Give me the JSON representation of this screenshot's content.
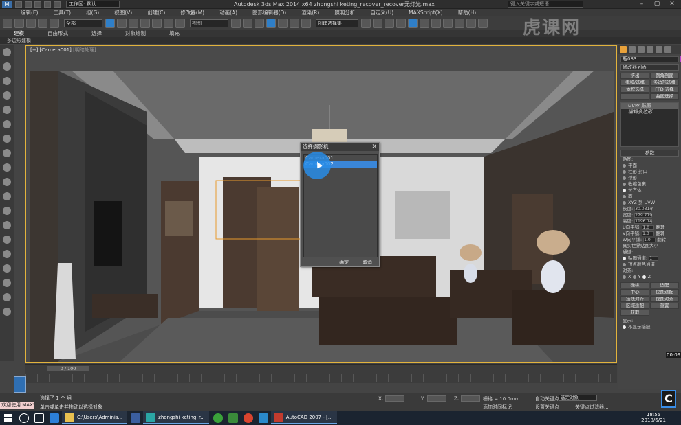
{
  "window": {
    "workspace_label": "工作区: 默认",
    "title": "Autodesk 3ds Max  2014 x64      zhongshi keting_recover_recover无灯光.max",
    "search_placeholder": "键入关键字或短语"
  },
  "menu": [
    "编辑(E)",
    "工具(T)",
    "组(G)",
    "视图(V)",
    "创建(C)",
    "修改器(M)",
    "动画(A)",
    "图形编辑器(D)",
    "渲染(R)",
    "照明分析",
    "自定义(U)",
    "MAXScript(X)",
    "帮助(H)"
  ],
  "toolbar": {
    "filter_value": "全部",
    "view_value": "视图",
    "selection_set_value": "创建选择集"
  },
  "ribbon": {
    "tabs": [
      "建模",
      "自由形式",
      "选择",
      "对象绘制",
      "填充"
    ],
    "sub_label": "多边形建模"
  },
  "viewport": {
    "label": "[+] [Camera001]",
    "label_dim": "[明暗处理]"
  },
  "dialog": {
    "title": "选择摄影机",
    "close": "✕",
    "items": [
      "Camera001",
      "Camera002"
    ],
    "ok_label": "确定",
    "cancel_label": "取消"
  },
  "command_panel": {
    "object_name": "瓶083",
    "modifier_list": "修改器列表",
    "buttons": [
      "挤出",
      "倒角剖面",
      "柔和/选择",
      "多边形选择",
      "体积选择",
      "FFD 选择",
      "",
      "曲面选择"
    ],
    "stack": [
      "UVW 贴图",
      "编辑多边形"
    ],
    "rollout_title": "参数",
    "mapping_label": "贴图:",
    "mapping_options": [
      "平面",
      "柱形",
      "封口",
      "球形",
      "收缩包裹",
      "长方体",
      "面",
      "XYZ 到 UVW"
    ],
    "length_label": "长度:",
    "length_value": "30.031m",
    "width_label": "宽度:",
    "width_value": "279.779",
    "height_label": "高度:",
    "height_value": "1196.14",
    "utile_label": "U向平铺:",
    "utile_value": "1.0",
    "vtile_label": "V向平铺:",
    "vtile_value": "1.0",
    "wtile_label": "W向平铺:",
    "wtile_value": "1.0",
    "flip_label": "翻转",
    "real_world_label": "真实世界贴图大小",
    "channel_label": "通道:",
    "map_channel_label": "贴图通道:",
    "map_channel_value": "1",
    "vertex_channel_label": "顶点颜色通道",
    "align_label": "对齐:",
    "align_axes": [
      "X",
      "Y",
      "Z"
    ],
    "align_buttons": [
      "操纵",
      "适配",
      "中心",
      "位图适配",
      "法线对齐",
      "视图对齐",
      "区域适配",
      "重置",
      "获取"
    ],
    "display_label": "显示:",
    "display_option": "不显示接缝"
  },
  "timeline": {
    "frame_label": "0 / 100"
  },
  "status": {
    "maxscript_label": "欢迎使用 MAXScri",
    "selected_text": "选择了 1 个 组",
    "hint_text": "单击或单击并拖动以选择对象",
    "x_label": "X:",
    "y_label": "Y:",
    "z_label": "Z:",
    "grid_label": "栅格 = 10.0mm",
    "add_time_tag": "添加时间标记",
    "auto_key": "自动关键点",
    "set_key": "设置关键点",
    "selected_object": "选定对象",
    "key_filter": "关键点过滤器..."
  },
  "taskbar": {
    "apps": [
      "C:\\Users\\Adminis...",
      "zhongshi keting_r...",
      "AutoCAD 2007 - [..."
    ],
    "time": "18:55",
    "date": "2018/6/21"
  },
  "overlay": {
    "watermark": "虎课网",
    "video_time": "00:09",
    "video_badge": "C"
  }
}
